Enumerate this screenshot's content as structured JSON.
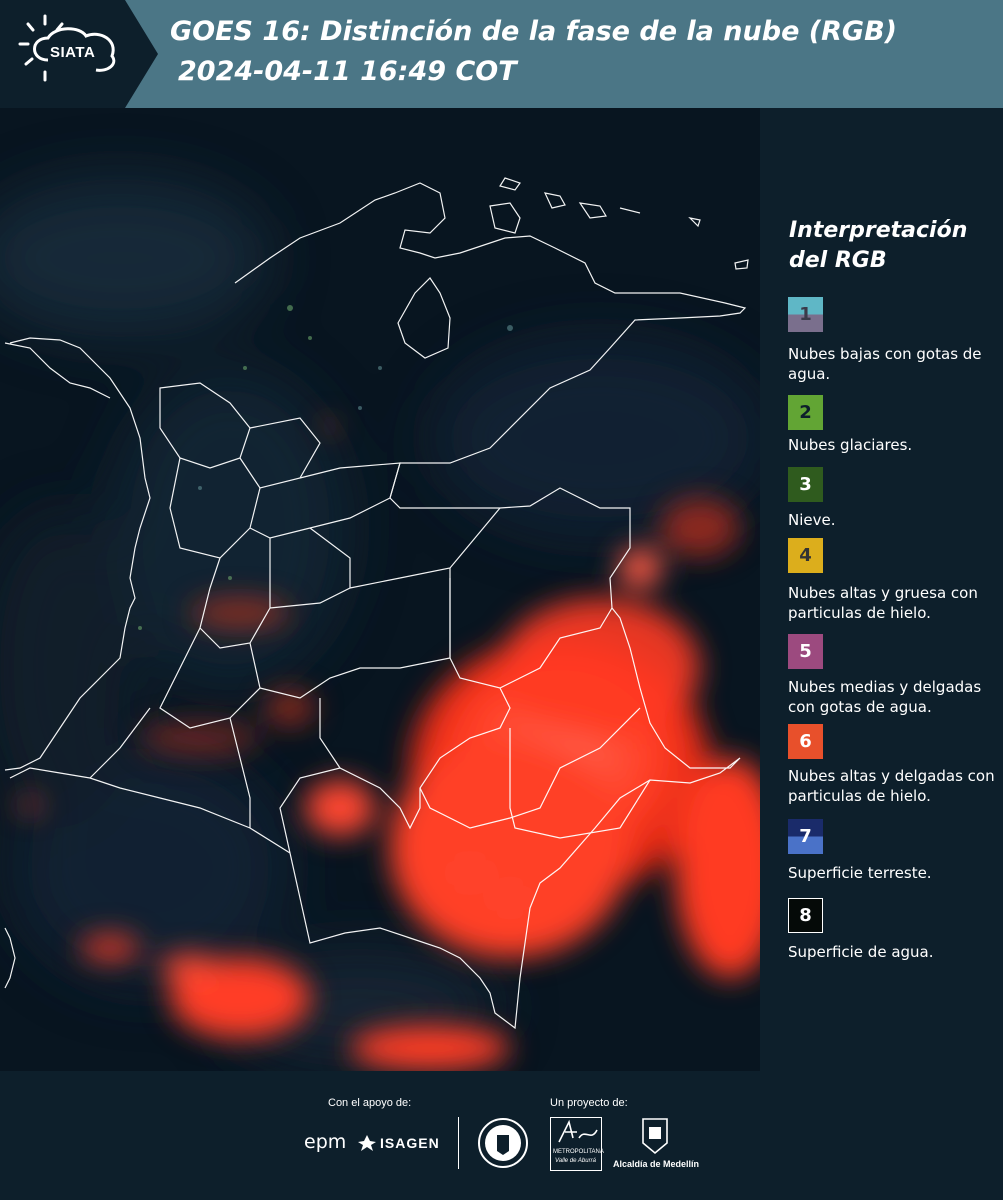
{
  "header": {
    "logo_text": "SIATA",
    "title_line1": "GOES 16: Distinción de la fase de la nube (RGB)",
    "title_line2": "2024-04-11 16:49 COT"
  },
  "legend": {
    "title": "Interpretación del RGB",
    "items": [
      {
        "number": "1",
        "description": "Nubes bajas con gotas de agua.",
        "color_top": "#5fb7c6",
        "color_bottom": "#7a6f8d"
      },
      {
        "number": "2",
        "description": "Nubes glaciares.",
        "color": "#62a534"
      },
      {
        "number": "3",
        "description": "Nieve.",
        "color": "#2f5b1e"
      },
      {
        "number": "4",
        "description": "Nubes altas y gruesa con particulas de hielo.",
        "color": "#dcae1c"
      },
      {
        "number": "5",
        "description": "Nubes medias y delgadas con gotas de agua.",
        "color": "#9c4a7f"
      },
      {
        "number": "6",
        "description": "Nubes altas y delgadas con particulas de hielo.",
        "color": "#e8502b"
      },
      {
        "number": "7",
        "description": "Superficie terreste.",
        "color_top": "#1a2b6a",
        "color_bottom": "#4a72c8"
      },
      {
        "number": "8",
        "description": "Superficie de agua.",
        "color": "#050a08"
      }
    ]
  },
  "footer": {
    "support_label": "Con el apoyo de:",
    "project_label": "Un proyecto de:",
    "sponsor_epm": "epm",
    "sponsor_isagen": "ISAGEN",
    "area_name": "METROPOLITANA",
    "area_sub": "Valle de Aburrá",
    "alcaldia": "Alcaldía de Medellín"
  },
  "colors": {
    "header_bg": "#4b7686",
    "logo_bg": "#0d1f2b",
    "panel_bg": "#0d1f2b",
    "cloud_red": "#ff3d22",
    "border_white": "#ffffff"
  }
}
